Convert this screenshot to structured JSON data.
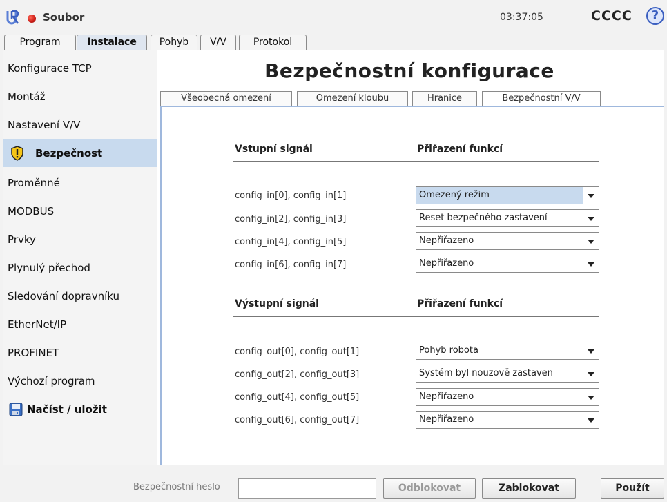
{
  "topbar": {
    "file_menu": "Soubor",
    "time": "03:37:05",
    "robot_name": "CCCC",
    "help_glyph": "?"
  },
  "main_tabs": [
    "Program",
    "Instalace",
    "Pohyb",
    "V/V",
    "Protokol"
  ],
  "active_main_tab": "Instalace",
  "sidebar": {
    "items": [
      {
        "label": "Konfigurace TCP"
      },
      {
        "label": "Montáž"
      },
      {
        "label": "Nastavení V/V"
      },
      {
        "label": "Bezpečnost",
        "icon": "shield-warning-icon"
      },
      {
        "label": "Proměnné"
      },
      {
        "label": "MODBUS"
      },
      {
        "label": "Prvky"
      },
      {
        "label": "Plynulý přechod"
      },
      {
        "label": "Sledování dopravníku"
      },
      {
        "label": "EtherNet/IP"
      },
      {
        "label": "PROFINET"
      },
      {
        "label": "Výchozí program"
      },
      {
        "label": "Načíst / uložit",
        "icon": "floppy-disk-icon"
      }
    ],
    "active": "Bezpečnost"
  },
  "page": {
    "title": "Bezpečnostní konfigurace",
    "subtabs": [
      "Všeobecná omezení",
      "Omezení kloubu",
      "Hranice",
      "Bezpečnostní V/V"
    ],
    "active_subtab": "Bezpečnostní V/V"
  },
  "inputs": {
    "header_signal": "Vstupní signál",
    "header_function": "Přiřazení funkcí",
    "rows": [
      {
        "signal": "config_in[0], config_in[1]",
        "value": "Omezený režim"
      },
      {
        "signal": "config_in[2], config_in[3]",
        "value": "Reset bezpečného zastavení"
      },
      {
        "signal": "config_in[4], config_in[5]",
        "value": "Nepřiřazeno"
      },
      {
        "signal": "config_in[6], config_in[7]",
        "value": "Nepřiřazeno"
      }
    ]
  },
  "outputs": {
    "header_signal": "Výstupní signál",
    "header_function": "Přiřazení funkcí",
    "rows": [
      {
        "signal": "config_out[0], config_out[1]",
        "value": "Pohyb robota"
      },
      {
        "signal": "config_out[2], config_out[3]",
        "value": "Systém byl nouzově zastaven"
      },
      {
        "signal": "config_out[4], config_out[5]",
        "value": "Nepřiřazeno"
      },
      {
        "signal": "config_out[6], config_out[7]",
        "value": "Nepřiřazeno"
      }
    ]
  },
  "footer": {
    "password_label": "Bezpečnostní heslo",
    "password_value": "",
    "unlock_label": "Odblokovat",
    "lock_label": "Zablokovat",
    "apply_label": "Použít"
  },
  "colors": {
    "selection": "#c8daee",
    "accent_blue": "#3b5fc0",
    "record_dot": "#d0201a"
  }
}
